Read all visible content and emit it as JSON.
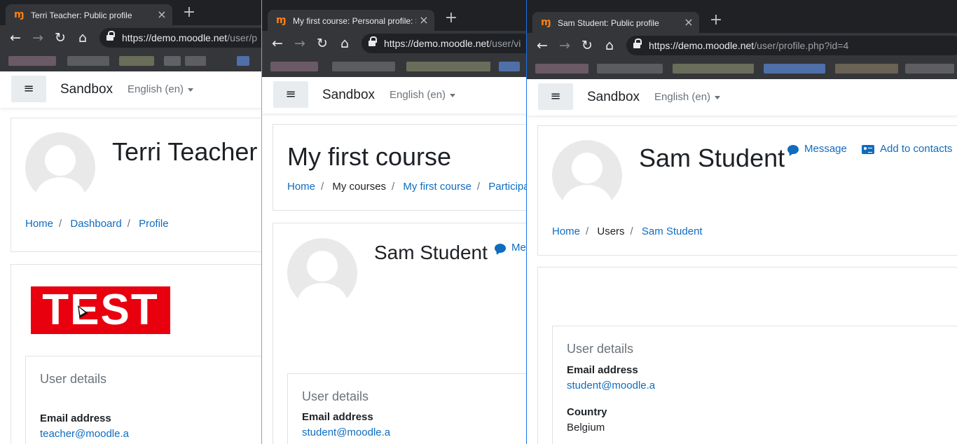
{
  "window_left": {
    "tab": {
      "title": "Terri Teacher: Public profile",
      "close": "×"
    },
    "newtab": "+",
    "url": {
      "host": "https://demo.moodle.net",
      "path": "/user/p"
    },
    "nav": {
      "brand": "Sandbox",
      "language": "English (en)"
    },
    "profile": {
      "name": "Terri Teacher"
    },
    "breadcrumb": [
      "Home",
      "Dashboard",
      "Profile"
    ],
    "test_image_text": "TEST",
    "user_details": {
      "heading": "User details",
      "email_label": "Email address",
      "email_value": "teacher@moodle.a"
    }
  },
  "window_middle": {
    "tab": {
      "title": "My first course: Personal profile: S",
      "close": "×"
    },
    "newtab": "+",
    "url": {
      "host": "https://demo.moodle.net",
      "path": "/user/vi"
    },
    "nav": {
      "brand": "Sandbox",
      "language": "English (en)"
    },
    "course_header": {
      "title": "My first course"
    },
    "breadcrumb": [
      "Home",
      "My courses",
      "My first course",
      "Participa"
    ],
    "profile": {
      "name": "Sam Student",
      "message_action": "Me"
    },
    "user_details": {
      "heading": "User details",
      "email_label": "Email address",
      "email_value": "student@moodle.a"
    }
  },
  "window_right": {
    "tab": {
      "title": "Sam Student: Public profile",
      "close": "×"
    },
    "newtab": "+",
    "url": {
      "host": "https://demo.moodle.net",
      "path": "/user/profile.php?id=4"
    },
    "nav": {
      "brand": "Sandbox",
      "language": "English (en)"
    },
    "profile": {
      "name": "Sam Student",
      "message_action": "Message",
      "contacts_action": "Add to contacts"
    },
    "breadcrumb": [
      "Home",
      "Users",
      "Sam Student"
    ],
    "user_details": {
      "heading": "User details",
      "email_label": "Email address",
      "email_value": "student@moodle.a",
      "country_label": "Country",
      "country_value": "Belgium"
    }
  },
  "colors": {
    "chrome_dark": "#202124",
    "chrome_toolbar": "#35363a",
    "moodle_link": "#0f6cbf",
    "moodle_orange": "#f98012",
    "test_red": "#e8000f",
    "active_window_border": "#1a73e8"
  },
  "icons": [
    "moodle-favicon",
    "back-arrow-icon",
    "forward-arrow-icon",
    "reload-icon",
    "home-icon",
    "lock-icon",
    "hamburger-icon",
    "caret-down-icon",
    "message-icon",
    "add-contact-icon",
    "mouse-cursor-icon"
  ]
}
